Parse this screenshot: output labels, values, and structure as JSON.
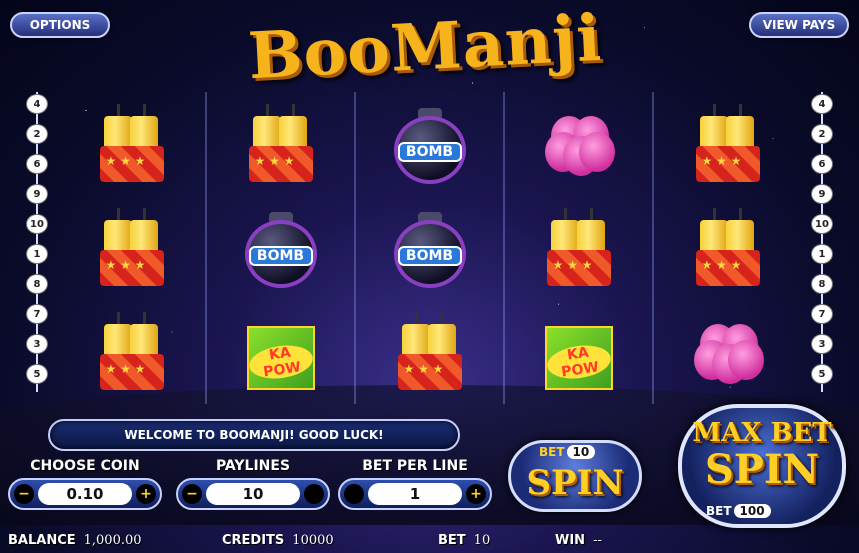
{
  "header": {
    "options_label": "OPTIONS",
    "view_pays_label": "VIEW PAYS",
    "logo_text": "BooManji"
  },
  "paylines": {
    "left": [
      "4",
      "2",
      "6",
      "9",
      "10",
      "1",
      "8",
      "7",
      "3",
      "5"
    ],
    "right": [
      "4",
      "2",
      "6",
      "9",
      "10",
      "1",
      "8",
      "7",
      "3",
      "5"
    ]
  },
  "reels": [
    [
      "dynamite",
      "dynamite",
      "dynamite"
    ],
    [
      "dynamite",
      "bomb",
      "kapow-box"
    ],
    [
      "bomb",
      "bomb",
      "dynamite"
    ],
    [
      "pink-firework",
      "dynamite",
      "kapow-box"
    ],
    [
      "dynamite",
      "dynamite",
      "pink-firework"
    ]
  ],
  "symbol_text": {
    "bomb": "BOMB",
    "kapow": "KA POW"
  },
  "message": "WELCOME TO BOOMANJI!  GOOD LUCK!",
  "controls": {
    "coin": {
      "title": "CHOOSE COIN",
      "value": "0.10",
      "minus": "−",
      "plus": "+"
    },
    "paylines": {
      "title": "PAYLINES",
      "value": "10",
      "minus": "−"
    },
    "bet_per_line": {
      "title": "BET PER LINE",
      "value": "1",
      "plus": "+"
    }
  },
  "spin": {
    "bet_label": "BET",
    "bet_value": "10",
    "label": "SPIN"
  },
  "max_bet_spin": {
    "line1": "MAX BET",
    "line2": "SPIN",
    "bet_label": "BET",
    "bet_value": "100"
  },
  "status": {
    "balance_label": "BALANCE",
    "balance_value": "1,000.00",
    "credits_label": "CREDITS",
    "credits_value": "10000",
    "bet_label": "BET",
    "bet_value": "10",
    "win_label": "WIN",
    "win_value": "--"
  },
  "colors": {
    "accent_gold": "#ffcf25",
    "panel_blue": "#1b2b76",
    "reel_bg": "#0a0b2a"
  }
}
